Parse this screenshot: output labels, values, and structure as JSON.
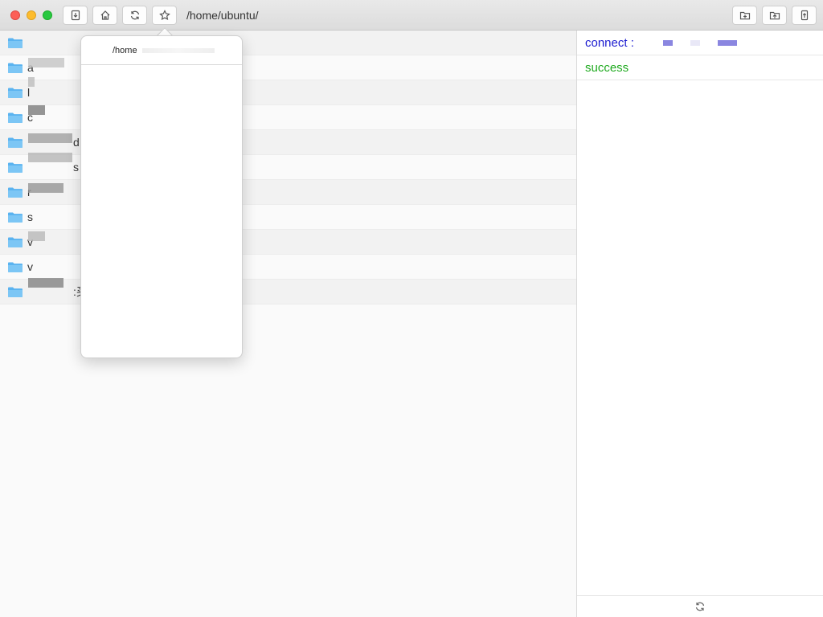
{
  "toolbar": {
    "path": "/home/ubuntu/",
    "buttons": [
      {
        "name": "download-button",
        "icon": "download-icon"
      },
      {
        "name": "home-button",
        "icon": "home-icon"
      },
      {
        "name": "refresh-button",
        "icon": "refresh-icon"
      },
      {
        "name": "bookmark-button",
        "icon": "star-icon"
      }
    ],
    "right_buttons": [
      {
        "name": "new-folder-button",
        "icon": "folder-plus-icon"
      },
      {
        "name": "upload-folder-button",
        "icon": "folder-upload-icon"
      },
      {
        "name": "upload-file-button",
        "icon": "file-upload-icon"
      }
    ]
  },
  "files": [
    {
      "name": "",
      "icon": "folder-icon"
    },
    {
      "name": "a",
      "icon": "folder-icon"
    },
    {
      "name": "l",
      "icon": "folder-icon"
    },
    {
      "name": "c",
      "icon": "folder-icon"
    },
    {
      "name": "d",
      "icon": "folder-icon"
    },
    {
      "name": "s",
      "icon": "folder-icon"
    },
    {
      "name": "r",
      "icon": "folder-icon"
    },
    {
      "name": "s",
      "icon": "folder-icon"
    },
    {
      "name": "v",
      "icon": "folder-icon"
    },
    {
      "name": "v",
      "icon": "folder-icon"
    },
    {
      "name": ":买",
      "icon": "folder-icon"
    }
  ],
  "log": {
    "connect": "connect : ",
    "success": "success"
  },
  "popover": {
    "items": [
      "/home"
    ]
  },
  "colors": {
    "folder": "#5ab3f0",
    "connect": "#1b1bd0",
    "success": "#1faa1f"
  }
}
